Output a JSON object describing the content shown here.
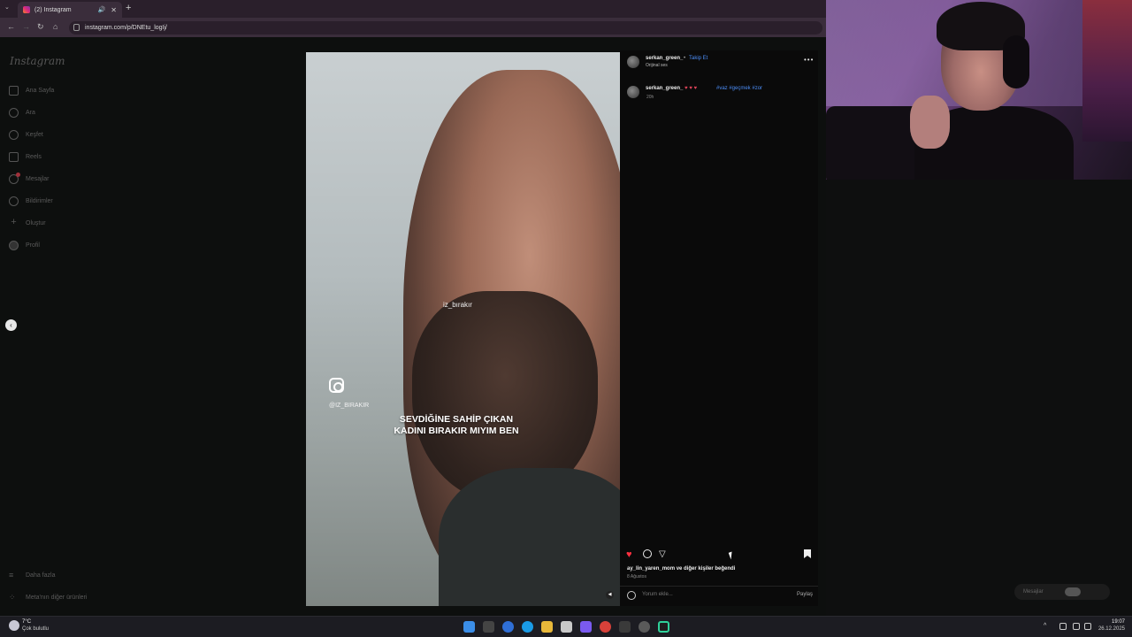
{
  "browser": {
    "tab_title": "(2) Instagram",
    "url": "instagram.com/p/DNEtu_logIj/"
  },
  "instagram": {
    "logo": "Instagram",
    "sidebar": [
      {
        "label": "Ana Sayfa",
        "icon": "home-icon"
      },
      {
        "label": "Ara",
        "icon": "search-icon"
      },
      {
        "label": "Keşfet",
        "icon": "compass-icon"
      },
      {
        "label": "Reels",
        "icon": "reels-icon"
      },
      {
        "label": "Mesajlar",
        "icon": "messenger-icon"
      },
      {
        "label": "Bildirimler",
        "icon": "heart-icon"
      },
      {
        "label": "Oluştur",
        "icon": "plus-icon"
      },
      {
        "label": "Profil",
        "icon": "avatar-icon"
      }
    ],
    "sidebar_bottom": [
      {
        "label": "Daha fazla",
        "icon": "menu-icon"
      },
      {
        "label": "Meta'nın diğer ürünleri",
        "icon": "grid-icon"
      }
    ],
    "video": {
      "watermark": "iz_bırakır",
      "handle": "@IZ_BIRAKIR",
      "caption_line1": "SEVDİĞİNE SAHİP ÇIKAN",
      "caption_line2": "KADINI BIRAKIR MIYIM BEN"
    },
    "post": {
      "username": "serkan_green_",
      "dot": "•",
      "follow": "Takip Et",
      "audio": "Orijinal ses",
      "caption_emoji": "♥ ♥ ♥",
      "hashtags": "#vaz #geçmek #zor",
      "caption_time": "20h",
      "likes_text": "ay_lin_yaren_mom ve diğer kişiler beğendi",
      "date": "8 Ağustos",
      "comment_placeholder": "Yorum ekle...",
      "post_button": "Paylaş"
    },
    "messages_pill": "Mesajlar",
    "colors": {
      "accent": "#4c8df6",
      "like": "#ff3040"
    }
  },
  "taskbar": {
    "weather_temp": "7°C",
    "weather_desc": "Çok bulutlu",
    "time": "19:07",
    "date": "26.12.2025"
  }
}
